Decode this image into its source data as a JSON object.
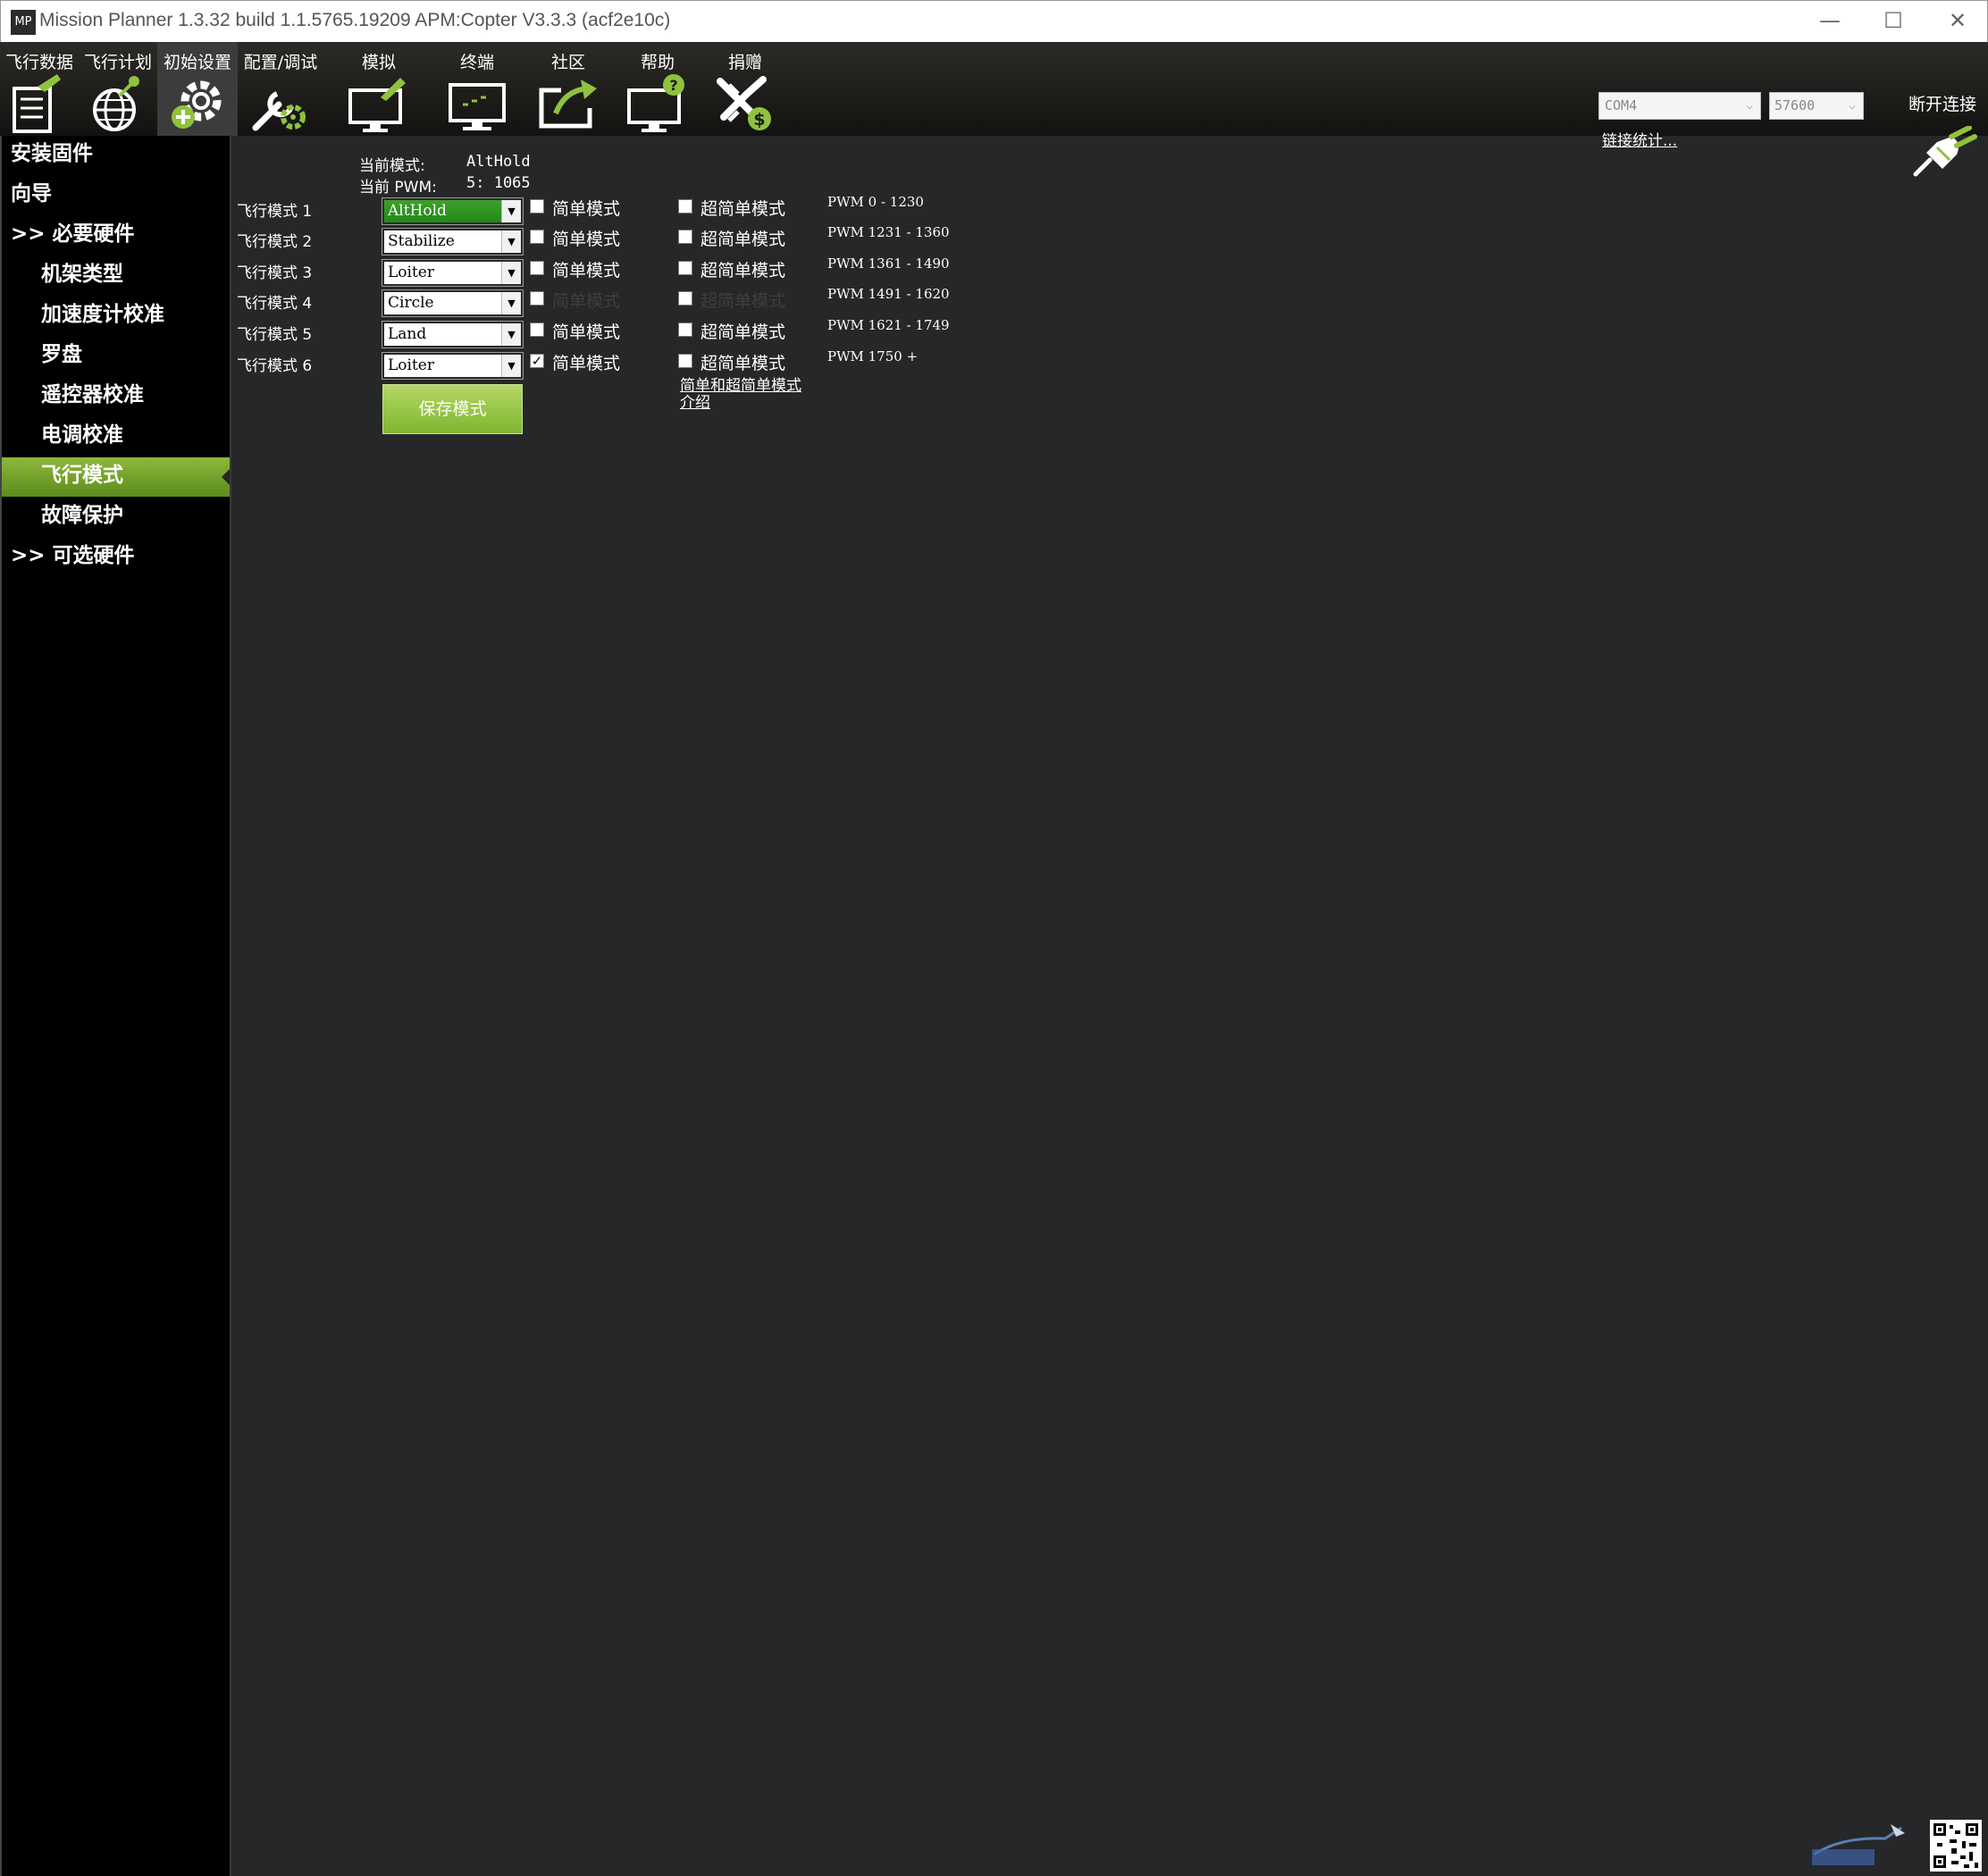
{
  "window": {
    "icon_text": "MP",
    "title": "Mission Planner 1.3.32 build 1.1.5765.19209 APM:Copter V3.3.3 (acf2e10c)",
    "minimize": "—",
    "maximize": "☐",
    "close": "✕"
  },
  "menu": {
    "items": [
      {
        "label": "飞行数据",
        "icon": "flight-data-icon"
      },
      {
        "label": "飞行计划",
        "icon": "flight-plan-icon"
      },
      {
        "label": "初始设置",
        "icon": "initial-setup-icon",
        "active": true
      },
      {
        "label": "配置/调试",
        "icon": "config-tuning-icon"
      },
      {
        "label": "模拟",
        "icon": "simulation-icon"
      },
      {
        "label": "终端",
        "icon": "terminal-icon"
      },
      {
        "label": "社区",
        "icon": "community-icon"
      },
      {
        "label": "帮助",
        "icon": "help-icon"
      },
      {
        "label": "捐赠",
        "icon": "donate-icon"
      }
    ]
  },
  "connection": {
    "port": "COM4",
    "baud": "57600",
    "link_stats": "链接统计...",
    "connect_label": "断开连接"
  },
  "sidebar": {
    "items": [
      {
        "label": "安装固件"
      },
      {
        "label": "向导"
      },
      {
        "label": ">> 必要硬件"
      },
      {
        "label": "机架类型"
      },
      {
        "label": "加速度计校准"
      },
      {
        "label": "罗盘"
      },
      {
        "label": "遥控器校准"
      },
      {
        "label": "电调校准"
      },
      {
        "label": "飞行模式",
        "selected": true
      },
      {
        "label": "故障保护"
      },
      {
        "label": ">> 可选硬件"
      }
    ]
  },
  "status": {
    "current_mode_label": "当前模式:",
    "current_mode_value": "AltHold",
    "current_pwm_label": "当前 PWM:",
    "current_pwm_value": "5: 1065"
  },
  "flight_modes": [
    {
      "label": "飞行模式 1",
      "mode": "AltHold",
      "simple": false,
      "super_simple": false,
      "simple_label": "简单模式",
      "super_label": "超简单模式",
      "pwm": "PWM 0 - 1230"
    },
    {
      "label": "飞行模式 2",
      "mode": "Stabilize",
      "simple": false,
      "super_simple": false,
      "simple_label": "简单模式",
      "super_label": "超简单模式",
      "pwm": "PWM 1231 - 1360"
    },
    {
      "label": "飞行模式 3",
      "mode": "Loiter",
      "simple": false,
      "super_simple": false,
      "simple_label": "简单模式",
      "super_label": "超简单模式",
      "pwm": "PWM 1361 - 1490"
    },
    {
      "label": "飞行模式 4",
      "mode": "Circle",
      "simple": false,
      "super_simple": false,
      "simple_label": "简单模式",
      "super_label": "超简单模式",
      "pwm": "PWM 1491 - 1620"
    },
    {
      "label": "飞行模式 5",
      "mode": "Land",
      "simple": false,
      "super_simple": false,
      "simple_label": "简单模式",
      "super_label": "超简单模式",
      "pwm": "PWM 1621 - 1749"
    },
    {
      "label": "飞行模式 6",
      "mode": "Loiter",
      "simple": true,
      "super_simple": false,
      "simple_label": "简单模式",
      "super_label": "超简单模式",
      "pwm": "PWM 1750 +"
    }
  ],
  "actions": {
    "save_label": "保存模式",
    "help_link_line1": "简单和超简单模式",
    "help_link_line2": "介绍"
  },
  "colors": {
    "accent_green": "#7fb52e",
    "current_mode_green": "#1f8a14",
    "content_bg": "#262729",
    "sidebar_bg": "#000000"
  }
}
